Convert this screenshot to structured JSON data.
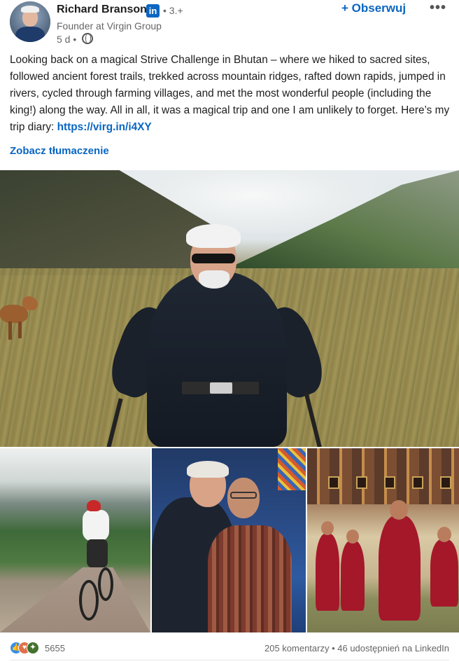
{
  "author": {
    "name": "Richard Branson",
    "linkedin_badge": "in",
    "degree": "• 3.+",
    "headline": "Founder at Virgin Group",
    "time": "5 d •",
    "visibility_icon": "globe-icon"
  },
  "actions": {
    "follow_label": "+ Obserwuj",
    "more_label": "•••"
  },
  "post": {
    "text": "Looking back on a magical Strive Challenge in Bhutan – where we hiked to sacred sites, followed ancient forest trails, trekked across mountain ridges, rafted down rapids, jumped in rivers, cycled through farming villages, and met the most wonderful people (including the king!) along the way. All in all, it was a magical trip and one I am unlikely to forget. Here’s my trip diary:",
    "link": "https://virg.in/i4XY",
    "translate_label": "Zobacz tłumaczenie"
  },
  "photos": [
    {
      "name": "photo-hiking-valley"
    },
    {
      "name": "photo-cycling"
    },
    {
      "name": "photo-two-men"
    },
    {
      "name": "photo-monks"
    }
  ],
  "engagement": {
    "reaction_icons": [
      "like-icon",
      "love-icon",
      "celebrate-icon"
    ],
    "reaction_count": "5655",
    "comments_shares": "205 komentarzy • 46 udostępnień na LinkedIn"
  },
  "colors": {
    "accent": "#0a66c2",
    "text": "#1d1d1d",
    "muted": "#666666"
  }
}
